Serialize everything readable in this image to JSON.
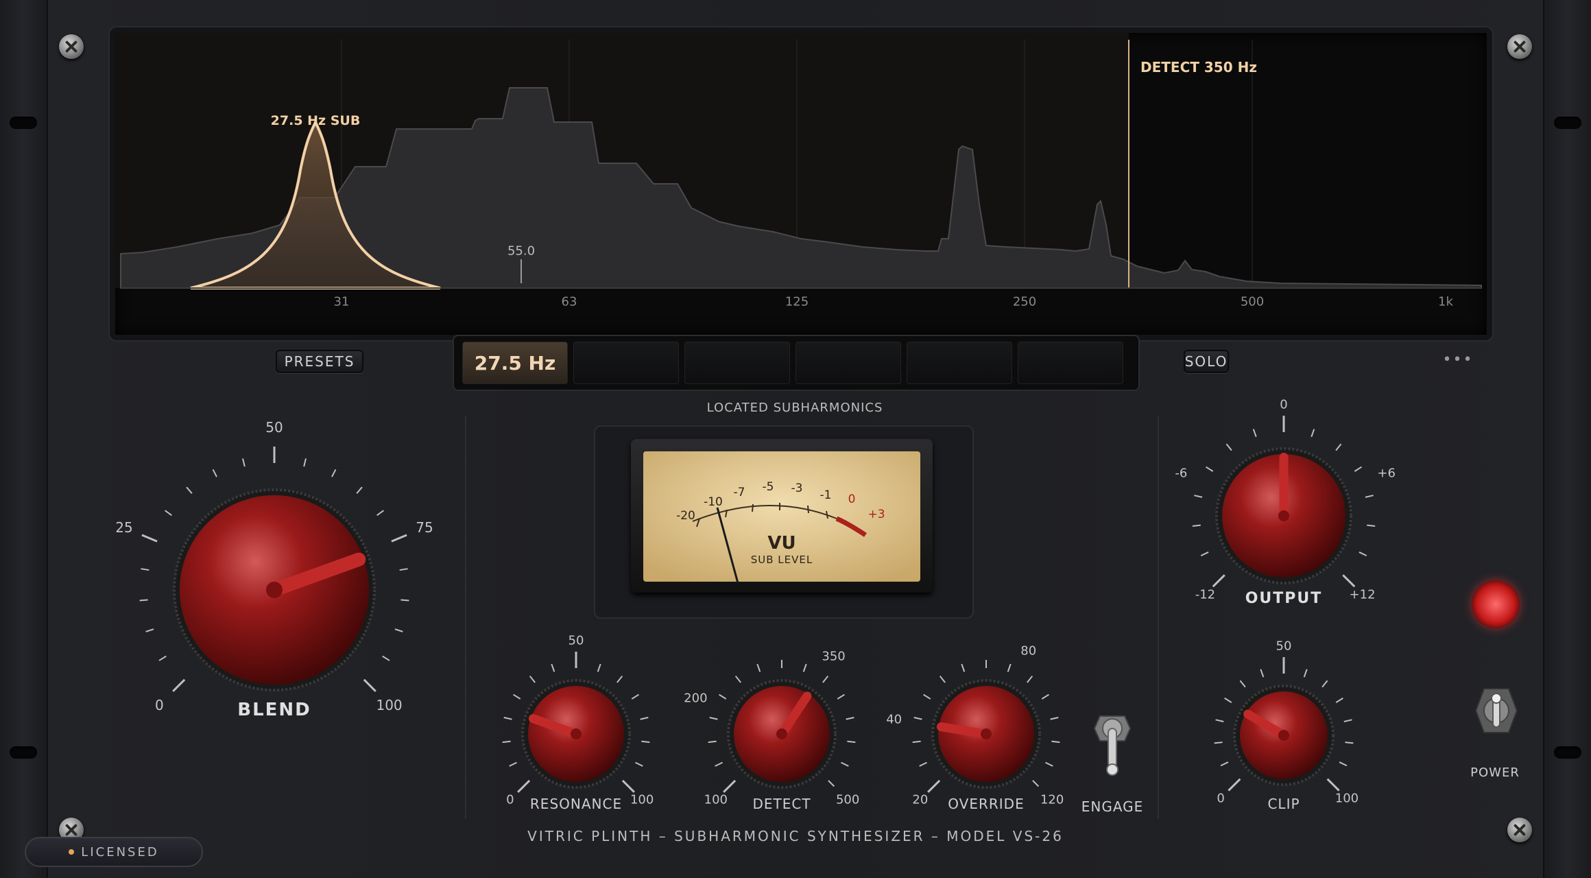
{
  "spectrum": {
    "x_ticks": [
      "31",
      "63",
      "125",
      "250",
      "500",
      "1k"
    ],
    "sub_peak_label": "27.5 Hz  SUB",
    "detect_label": "DETECT 350 Hz",
    "marker_value": "55.0"
  },
  "toolbar": {
    "presets_label": "PRESETS",
    "solo_label": "SOLO",
    "more_label": "•••"
  },
  "bands": [
    "27.5 Hz",
    "",
    "",
    "",
    "",
    ""
  ],
  "section_label": "LOCATED SUBHARMONICS",
  "vu": {
    "scale": [
      "-20",
      "-10",
      "-7",
      "-5",
      "-3",
      "-1",
      "0",
      "+3"
    ],
    "title": "VU",
    "subtitle": "SUB LEVEL"
  },
  "knobs": {
    "blend": {
      "title": "BLEND",
      "scale": [
        "0",
        "25",
        "50",
        "75",
        "100"
      ],
      "value": 76
    },
    "resonance": {
      "title": "RESONANCE",
      "scale": [
        "0",
        "50",
        "100"
      ],
      "value": 24
    },
    "detect": {
      "title": "DETECT",
      "scale": [
        "100",
        "200",
        "350",
        "500"
      ],
      "value": 350
    },
    "override": {
      "title": "OVERRIDE",
      "scale": [
        "20",
        "40",
        "80",
        "120"
      ],
      "value": 40
    },
    "output": {
      "title": "OUTPUT",
      "scale": [
        "-12",
        "-6",
        "0",
        "+6",
        "+12"
      ],
      "value": 0
    },
    "clip": {
      "title": "CLIP",
      "scale": [
        "0",
        "50",
        "100"
      ],
      "value": 28
    }
  },
  "engage_label": "ENGAGE",
  "power_label": "POWER",
  "footer": "VITRIC PLINTH   –   SUBHARMONIC SYNTHESIZER   –   MODEL VS-26",
  "license_label": "LICENSED",
  "colors": {
    "accent": "#f3d1a6",
    "knob": "#8f1414",
    "panel": "#1e1f22",
    "vu_face": "#e6cf9c"
  }
}
